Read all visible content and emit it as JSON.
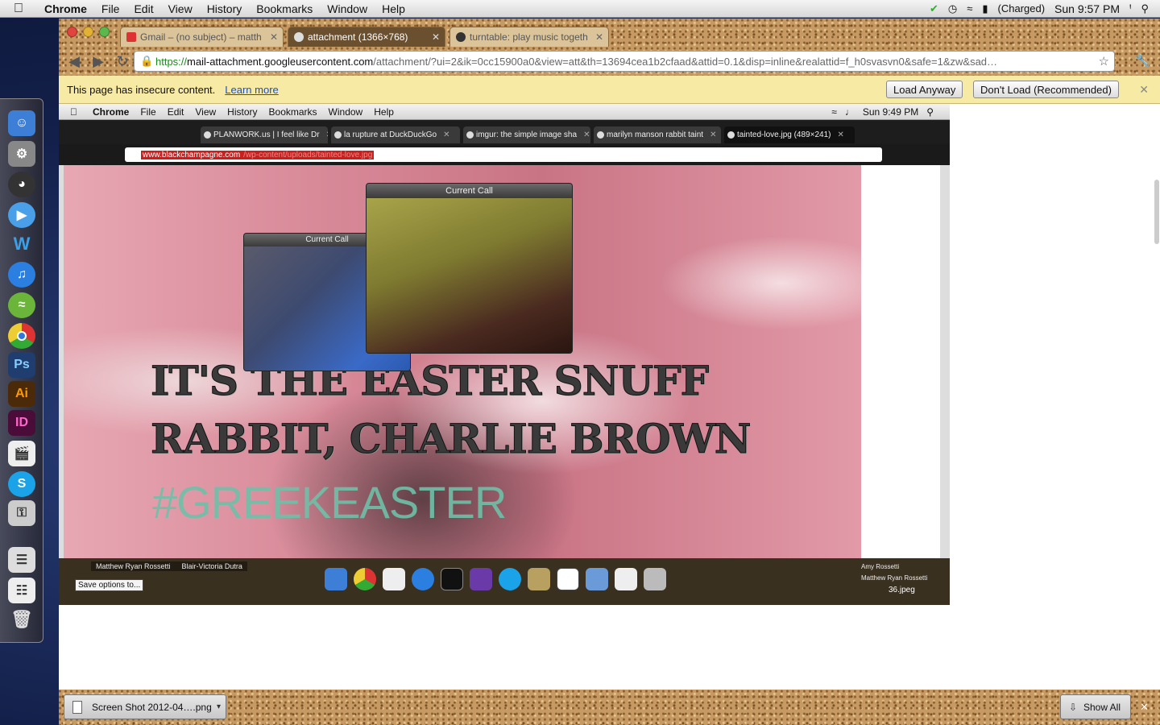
{
  "menubar": {
    "app": "Chrome",
    "items": [
      "File",
      "Edit",
      "View",
      "History",
      "Bookmarks",
      "Window",
      "Help"
    ],
    "battery": "(Charged)",
    "clock": "Sun 9:57 PM"
  },
  "tabs": [
    {
      "label": "Gmail – (no subject) – matth",
      "icon": "gmail-icon"
    },
    {
      "label": "attachment (1366×768)",
      "icon": "globe-icon"
    },
    {
      "label": "turntable: play music togeth",
      "icon": "headphones-icon"
    }
  ],
  "address": {
    "scheme": "https://",
    "host": "mail-attachment.googleusercontent.com",
    "path": "/attachment/?ui=2&ik=0cc15900a0&view=att&th=13694cea1b2cfaad&attid=0.1&disp=inline&realattid=f_h0svasvn0&safe=1&zw&sad…"
  },
  "infobar": {
    "message": "This page has insecure content.",
    "learn_more": "Learn more",
    "load_anyway": "Load Anyway",
    "dont_load": "Don't Load (Recommended)"
  },
  "screenshot": {
    "menubar": {
      "app": "Chrome",
      "items": [
        "File",
        "Edit",
        "View",
        "History",
        "Bookmarks",
        "Window",
        "Help"
      ],
      "clock": "Sun 9:49 PM"
    },
    "tabs": [
      "PLANWORK.us | I feel like Dr",
      "la rupture at DuckDuckGo",
      "imgur: the simple image sha",
      "marilyn manson rabbit taint",
      "tainted-love.jpg (489×241)"
    ],
    "url_host": "www.blackchampagne.com",
    "url_path": "/wp-content/uploads/tainted-love.jpg",
    "call_small_title": "Current Call",
    "call_large_title": "Current Call",
    "headline": "IT'S THE EASTER SNUFF RABBIT, CHARLIE BROWN",
    "hashtag": "#GREEKEASTER",
    "contacts_left": [
      "Matthew Ryan Rossetti",
      "Blair-Victoria Dutra"
    ],
    "save_options": "Save options to...",
    "contacts_right": [
      "Amy Rossetti",
      "Matthew Ryan Rossetti"
    ],
    "file_label": "36.jpeg"
  },
  "shelf": {
    "download": "Screen Shot 2012-04….png",
    "show_all": "Show All"
  },
  "colors": {
    "infobar": "#f7eaa5",
    "link": "#1a4fc8",
    "hashtag": "#6fc0a8",
    "url_highlight": "#c6211f"
  }
}
